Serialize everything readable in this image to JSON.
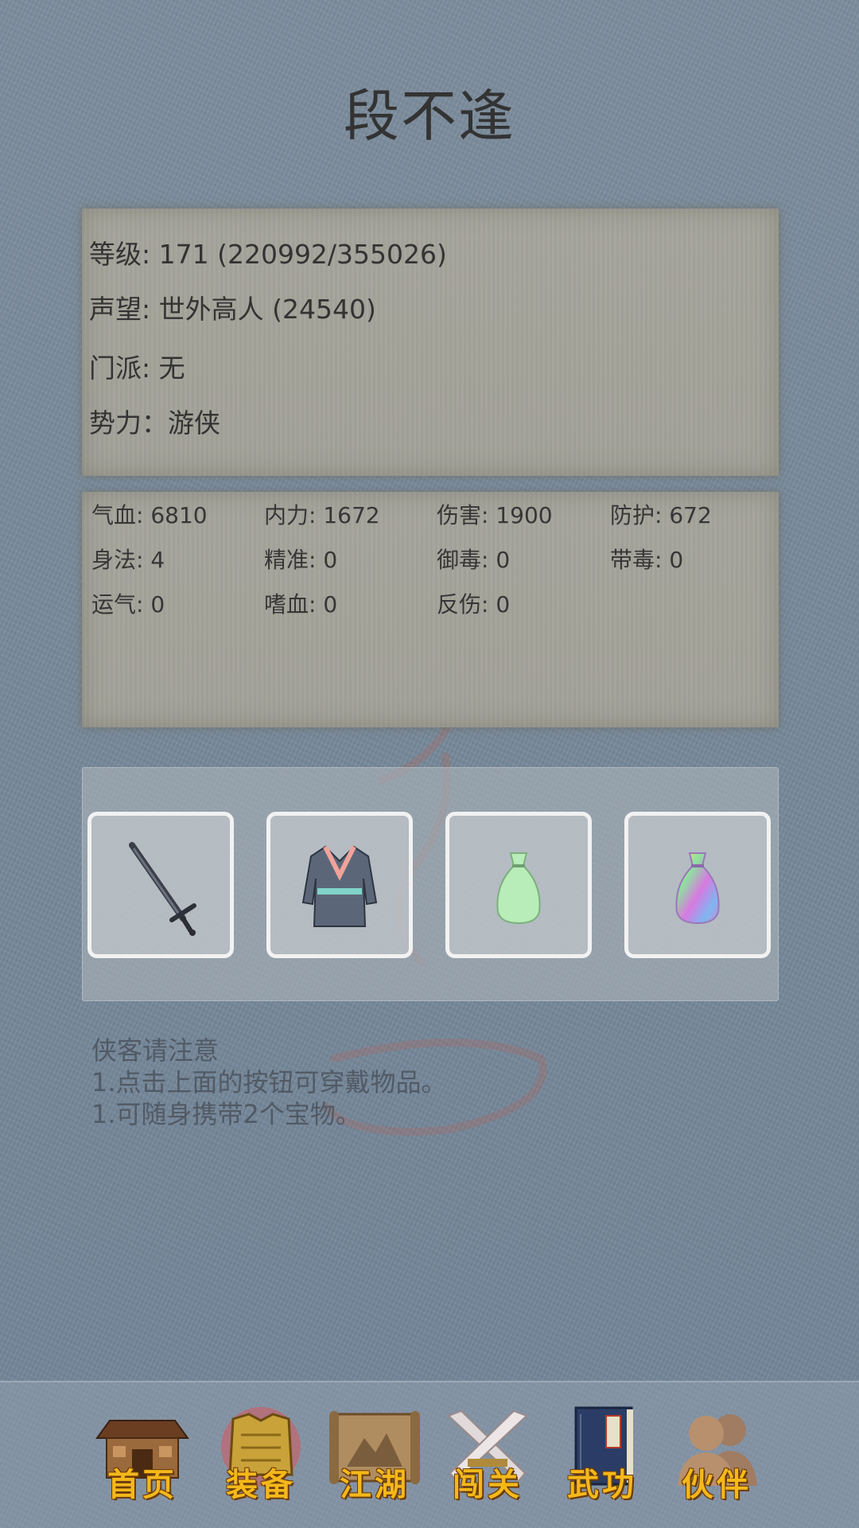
{
  "character": {
    "name": "段不逢"
  },
  "info": {
    "level": "等级: 171 (220992/355026)",
    "reputation": "声望: 世外高人 (24540)",
    "sect": "门派: 无",
    "faction": "势力：游侠"
  },
  "stats": [
    "气血: 6810",
    "内力: 1672",
    "伤害: 1900",
    "防护: 672",
    "身法: 4",
    "精准: 0",
    "御毒: 0",
    "带毒: 0",
    "运气: 0",
    "嗜血: 0",
    "反伤: 0"
  ],
  "equipment": [
    {
      "icon": "sword-icon"
    },
    {
      "icon": "robe-icon"
    },
    {
      "icon": "green-pouch-icon"
    },
    {
      "icon": "rainbow-pouch-icon"
    }
  ],
  "notice": {
    "title": "侠客请注意",
    "line1": "1.点击上面的按钮可穿戴物品。",
    "line2": "1.可随身携带2个宝物。"
  },
  "nav": {
    "home": "首页",
    "equipment": "装备",
    "jianghu": "江湖",
    "challenge": "闯关",
    "martial": "武功",
    "partner": "伙伴"
  },
  "colors": {
    "background": "#7b8c9c",
    "paper": "#a5a49b",
    "nav_label": "#f4b81a",
    "title": "#333333"
  }
}
